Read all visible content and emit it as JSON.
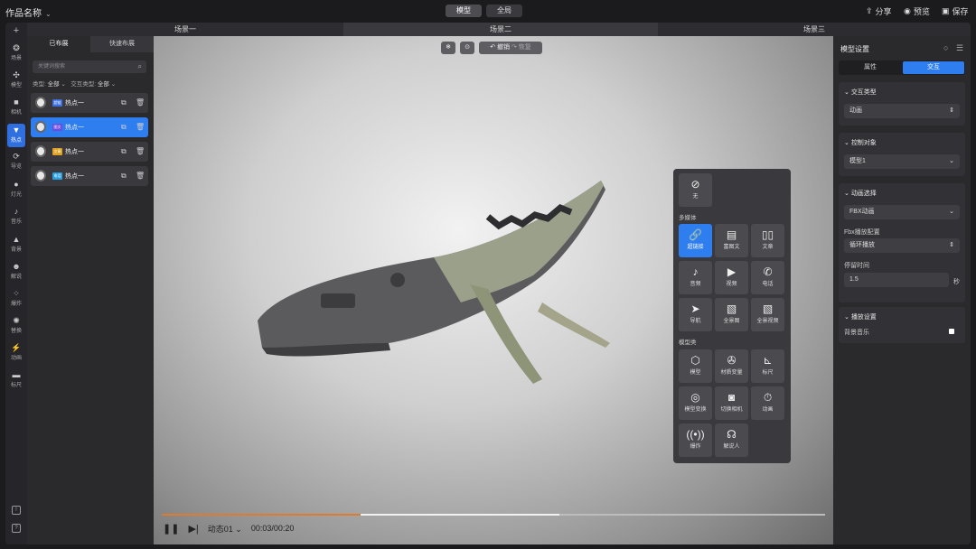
{
  "app": {
    "title": "作品名称",
    "mode_tabs": [
      "模型",
      "全局"
    ],
    "actions": [
      {
        "icon": "share-icon",
        "label": "分享"
      },
      {
        "icon": "preview-icon",
        "label": "预览"
      },
      {
        "icon": "save-icon",
        "label": "保存"
      }
    ]
  },
  "rail": {
    "items": [
      "场景",
      "模型",
      "相机",
      "热点",
      "导览",
      "灯光",
      "音乐",
      "背景",
      "解说",
      "爆炸",
      "替换",
      "动画",
      "标尺"
    ],
    "active": "热点"
  },
  "scenes": [
    "场景一",
    "场景二",
    "场景三"
  ],
  "left": {
    "tabs": [
      "已布展",
      "快速布展"
    ],
    "search_placeholder": "关键词搜索",
    "filter_type_label": "类型:",
    "filter_type_value": "全部",
    "filter_inter_label": "交互类型:",
    "filter_inter_value": "全部",
    "hotspots": [
      {
        "badge": "超链",
        "badge_color": "#3b6fe0",
        "name": "热点一"
      },
      {
        "badge": "图文",
        "badge_color": "#6d4ae0",
        "name": "热点一"
      },
      {
        "badge": "文章",
        "badge_color": "#e0a020",
        "name": "热点一"
      },
      {
        "badge": "电话",
        "badge_color": "#2aa0e0",
        "name": "热点一"
      }
    ]
  },
  "viewport": {
    "undo": "撤销",
    "redo": "恢复"
  },
  "popup": {
    "none": "无",
    "sec1": "多媒体",
    "sec2": "模型类",
    "media": [
      "超链接",
      "富图文",
      "文章",
      "音频",
      "视频",
      "电话",
      "导航",
      "全景图",
      "全景视频"
    ],
    "model": [
      "模型",
      "材质变量",
      "标尺",
      "模型变换",
      "切换相机",
      "动画",
      "爆炸",
      "解说人"
    ]
  },
  "player": {
    "anim": "动态01",
    "time": "00:03/00:20",
    "progress_played": 0.3,
    "progress_buffered": 0.6
  },
  "right": {
    "title": "模型设置",
    "tabs": [
      "属性",
      "交互"
    ],
    "s1": "交互类型",
    "s1_val": "动画",
    "s2": "控制对象",
    "s2_val": "模型1",
    "s3": "动画选择",
    "s3_val": "FBX动画",
    "fbx_label": "Fbx播放配置",
    "fbx_val": "循环播放",
    "stay_label": "停留时间",
    "stay_val": "1.5",
    "stay_unit": "秒",
    "s4": "播放设置",
    "bgm": "背景音乐"
  }
}
